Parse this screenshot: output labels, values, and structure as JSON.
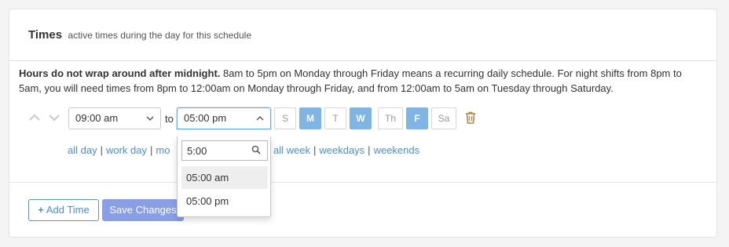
{
  "section": {
    "title": "Times",
    "subtitle": "active times during the day for this schedule"
  },
  "notice": {
    "bold": "Hours do not wrap around after midnight.",
    "text": " 8am to 5pm on Monday through Friday means a recurring daily schedule. For night shifts from 8pm to 5am, you will need times from 8pm to 12:00am on Monday through Friday, and from 12:00am to 5am on Tuesday through Saturday."
  },
  "time_row": {
    "start_value": "09:00 am",
    "to_label": "to",
    "end_value": "05:00 pm",
    "days": [
      {
        "label": "S",
        "active": false
      },
      {
        "label": "M",
        "active": true
      },
      {
        "label": "T",
        "active": false
      },
      {
        "label": "W",
        "active": true
      },
      {
        "label": "Th",
        "active": false
      },
      {
        "label": "F",
        "active": true
      },
      {
        "label": "Sa",
        "active": false
      }
    ]
  },
  "quick_links": {
    "all_day": "all day",
    "work_day": "work day",
    "partial": "mo",
    "all_week": "all week",
    "weekdays": "weekdays",
    "weekends": "weekends",
    "separator": "|"
  },
  "dropdown": {
    "search_value": "5:00",
    "options": [
      "05:00 am",
      "05:00 pm"
    ],
    "highlighted": "05:00 am"
  },
  "buttons": {
    "add_time": "Add Time",
    "save_changes": "Save Changes"
  },
  "colors": {
    "accent": "#4a8fd1",
    "day_active": "#7fb5e4",
    "save_button": "#8a9ee6",
    "trash": "#b08a4a"
  }
}
